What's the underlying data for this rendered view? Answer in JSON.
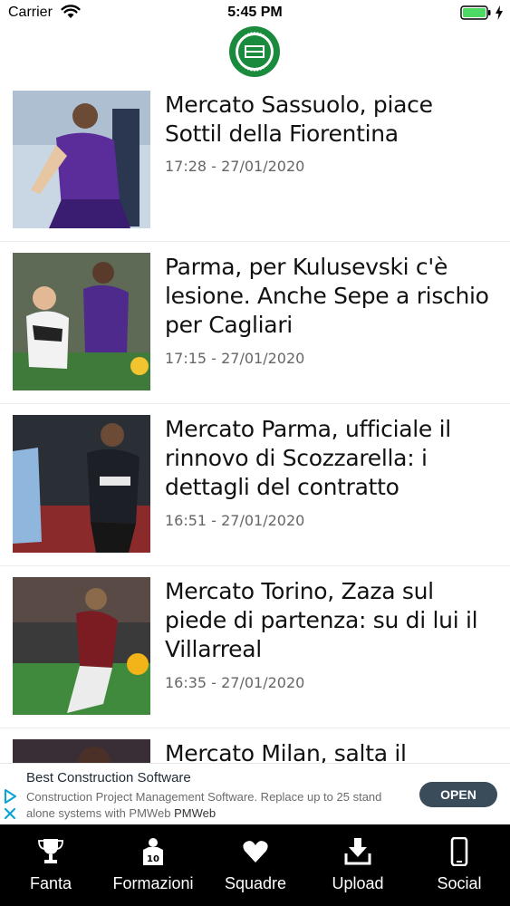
{
  "status_bar": {
    "carrier": "Carrier",
    "time": "5:45 PM",
    "wifi_icon": "wifi-icon",
    "battery_icon": "battery-icon",
    "battery_color": "#4cd964"
  },
  "header": {
    "logo_icon": "cronache-di-spogliatoio-logo",
    "logo_color": "#1a8a3c"
  },
  "articles": [
    {
      "headline": "Mercato Sassuolo, piace Sottil della Fiorentina",
      "time": "17:28",
      "date": "27/01/2020",
      "separator": "-"
    },
    {
      "headline": "Parma, per Kulusevski c'è lesione. Anche Sepe a rischio per Cagliari",
      "time": "17:15",
      "date": "27/01/2020",
      "separator": "-"
    },
    {
      "headline": "Mercato Parma, ufficiale il rinnovo di Scozzarella: i dettagli del contratto",
      "time": "16:51",
      "date": "27/01/2020",
      "separator": "-"
    },
    {
      "headline": "Mercato Torino, Zaza sul piede di partenza: su di lui il Villarreal",
      "time": "16:35",
      "date": "27/01/2020",
      "separator": "-"
    },
    {
      "headline": "Mercato Milan, salta il",
      "time": "",
      "date": "",
      "separator": ""
    }
  ],
  "ad": {
    "title": "Best Construction Software",
    "body": "Construction Project Management Software. Replace up to 25 stand alone systems with PMWeb",
    "brand": "PMWeb",
    "open_label": "OPEN",
    "accent": "#0aa3d8"
  },
  "tab_bar": {
    "items": [
      {
        "label": "Fanta",
        "icon": "trophy-icon"
      },
      {
        "label": "Formazioni",
        "icon": "jersey-icon"
      },
      {
        "label": "Squadre",
        "icon": "heart-icon"
      },
      {
        "label": "Upload",
        "icon": "upload-icon"
      },
      {
        "label": "Social",
        "icon": "phone-icon"
      }
    ],
    "background": "#000000"
  }
}
